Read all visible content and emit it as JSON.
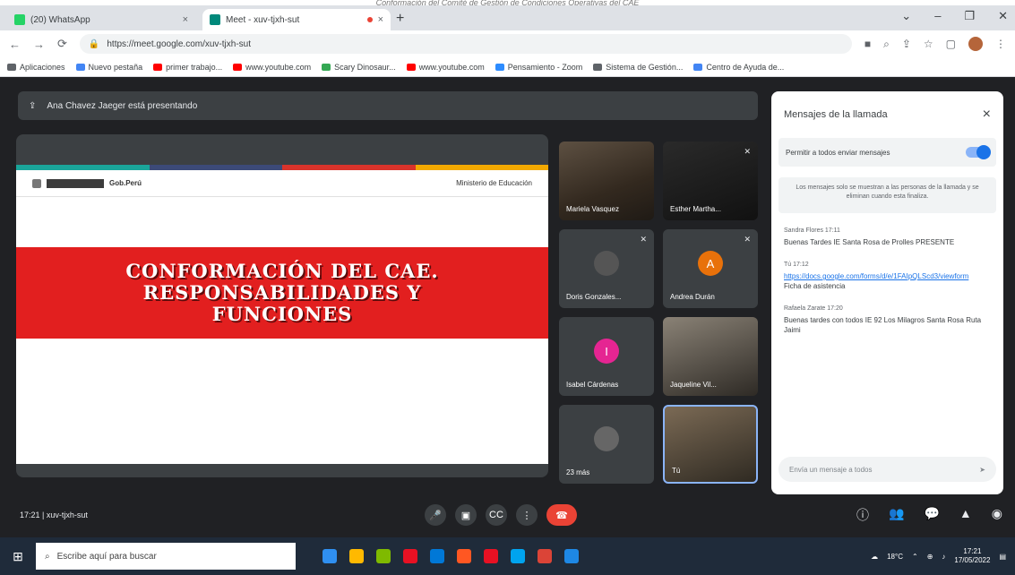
{
  "caption": "Conformación del Comité de Gestión de Condiciones Operativas del CAE",
  "browser": {
    "tabs": [
      {
        "title": "(20) WhatsApp",
        "close": "×",
        "fav": "#25d366"
      },
      {
        "title": "Meet - xuv-tjxh-sut",
        "close": "×",
        "fav": "#00897b"
      }
    ],
    "new_tab": "+",
    "url": "https://meet.google.com/xuv-tjxh-sut",
    "bookmarks": [
      {
        "label": "Aplicaciones",
        "color": "#5f6368"
      },
      {
        "label": "Nuevo pestaña",
        "color": "#4285f4"
      },
      {
        "label": "primer trabajo...",
        "color": "#ff0000"
      },
      {
        "label": "www.youtube.com",
        "color": "#ff0000"
      },
      {
        "label": "Scary Dinosaur...",
        "color": "#34a853"
      },
      {
        "label": "www.youtube.com",
        "color": "#ff0000"
      },
      {
        "label": "Pensamiento - Zoom",
        "color": "#2d8cff"
      },
      {
        "label": "Sistema de Gestión...",
        "color": "#5f6368"
      },
      {
        "label": "Centro de Ayuda de...",
        "color": "#4285f4"
      }
    ]
  },
  "meet": {
    "presenting_text": "Ana Chavez Jaeger está presentando",
    "slide": {
      "left_logo": "Gob.Perú",
      "right_logo": "Ministerio de Educación",
      "title": "CONFORMACIÓN DEL CAE. RESPONSABILIDADES Y FUNCIONES",
      "stripe_colors": [
        "#1aa59a",
        "#3c4a78",
        "#d9332b",
        "#f2a900"
      ]
    },
    "participants": [
      {
        "name": "Mariela Vasquez",
        "initial": "",
        "avatar_color": "",
        "kind": "video"
      },
      {
        "name": "Esther Martha...",
        "initial": "",
        "avatar_color": "",
        "kind": "video"
      },
      {
        "name": "Doris Gonzales...",
        "initial": "",
        "avatar_color": "#555",
        "kind": "photo"
      },
      {
        "name": "Andrea Durán",
        "initial": "A",
        "avatar_color": "#e8710a",
        "kind": "avatar"
      },
      {
        "name": "Isabel Cárdenas",
        "initial": "I",
        "avatar_color": "#e52592",
        "kind": "avatar"
      },
      {
        "name": "Jaqueline Vil...",
        "initial": "",
        "avatar_color": "",
        "kind": "video"
      },
      {
        "name": "23 más",
        "initial": "",
        "avatar_color": "#666",
        "kind": "photo"
      },
      {
        "name": "Tú",
        "initial": "",
        "avatar_color": "",
        "kind": "self"
      }
    ],
    "meeting_info": "17:21 | xuv-tjxh-sut"
  },
  "chat": {
    "title": "Mensajes de la llamada",
    "close": "×",
    "allow_label": "Permitir a todos enviar mensajes",
    "note": "Los mensajes solo se muestran a las personas de la llamada y se eliminan cuando esta finaliza.",
    "messages": [
      {
        "sender": "Sandra Flores 17:11",
        "text": "Buenas Tardes IE Santa Rosa de Prolles PRESENTE",
        "link": ""
      },
      {
        "sender": "Tú 17:12",
        "text": "Ficha de asistencia",
        "link": "https://docs.google.com/forms/d/e/1FAIpQLScd3/viewform"
      },
      {
        "sender": "Rafaela Zarate 17:20",
        "text": "Buenas tardes con todos IE 92 Los Milagros Santa Rosa Ruta Jaimi",
        "link": ""
      }
    ],
    "input_placeholder": "Envía un mensaje a todos",
    "send": "➤"
  },
  "controls": {
    "mic": "🎤",
    "cam": "▣",
    "captions": "CC",
    "more": "⋮",
    "end": "☎",
    "info": "ⓘ",
    "people": "👥",
    "chat": "💬",
    "activities": "▲",
    "shield": "◉"
  },
  "taskbar": {
    "start": "⊞",
    "search_placeholder": "Escribe aquí para buscar",
    "apps": [
      "#2f8ff0",
      "#ffb900",
      "#7fba00",
      "#e81123",
      "#0078d7",
      "#ff5722",
      "#e81123",
      "#00a4ef",
      "#1e88e5"
    ],
    "weather": "18°C",
    "time": "17:21",
    "date": "17/05/2022"
  }
}
